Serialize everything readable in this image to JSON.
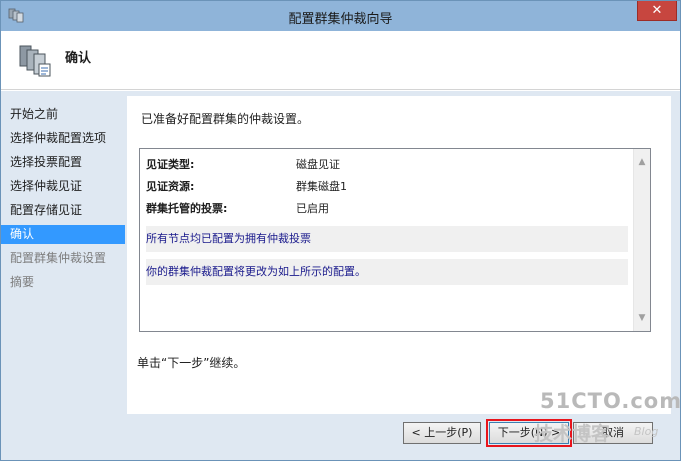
{
  "window": {
    "title": "配置群集仲裁向导",
    "close_label": "✕"
  },
  "header": {
    "title": "确认"
  },
  "nav": {
    "items": [
      {
        "label": "开始之前",
        "state": "done"
      },
      {
        "label": "选择仲裁配置选项",
        "state": "done"
      },
      {
        "label": "选择投票配置",
        "state": "done"
      },
      {
        "label": "选择仲裁见证",
        "state": "done"
      },
      {
        "label": "配置存储见证",
        "state": "done"
      },
      {
        "label": "确认",
        "state": "current"
      },
      {
        "label": "配置群集仲裁设置",
        "state": "future"
      },
      {
        "label": "摘要",
        "state": "future"
      }
    ]
  },
  "content": {
    "intro": "已准备好配置群集的仲裁设置。",
    "report": {
      "rows": [
        {
          "key": "见证类型:",
          "value": "磁盘见证"
        },
        {
          "key": "见证资源:",
          "value": "群集磁盘1"
        },
        {
          "key": "群集托管的投票:",
          "value": "已启用"
        }
      ],
      "notes": [
        "所有节点均已配置为拥有仲裁投票",
        "你的群集仲裁配置将更改为如上所示的配置。"
      ]
    },
    "hint": "单击“下一步”继续。"
  },
  "buttons": {
    "prev": "< 上一步(P)",
    "next": "下一步(N) >",
    "cancel": "取消"
  },
  "watermark": {
    "main": "51CTO.com",
    "sub": "技术博客",
    "blog": "Blog"
  },
  "colors": {
    "titlebar": "#8fb4d9",
    "frame": "#dfe8f2",
    "nav_selected": "#3399ff",
    "close": "#c7463f",
    "highlight_box": "#e8141c",
    "note_text": "#1a1a8c"
  },
  "icons": {
    "app": "cluster-icon",
    "header": "cluster-servers-icon"
  }
}
